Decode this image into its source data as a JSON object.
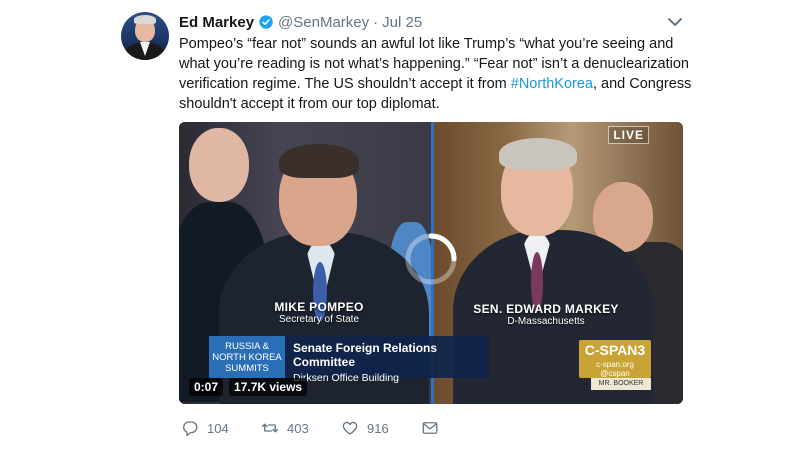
{
  "author": {
    "name": "Ed Markey",
    "handle": "@SenMarkey",
    "separator": "·",
    "date": "Jul 25"
  },
  "tweet": {
    "line1": "Pompeo’s “fear not” sounds an awful lot like Trump’s “what you’re seeing and",
    "line2": "what you’re reading is not what’s happening.” “Fear not” isn’t a denuclearization",
    "line3_pre": "verification regime. The US shouldn’t accept it from ",
    "hashtag": "#NorthKorea",
    "line3_post": ", and Congress",
    "line4": "shouldn't accept it from our top diplomat."
  },
  "video": {
    "live_badge": "LIVE",
    "left_name": "MIKE POMPEO",
    "left_title": "Secretary of State",
    "right_name": "SEN. EDWARD MARKEY",
    "right_title": "D-Massachusetts",
    "topic": "RUSSIA & NORTH KOREA SUMMITS",
    "event_title": "Senate Foreign Relations Committee",
    "event_location": "Dirksen Office Building",
    "network": "C-SPAN3",
    "network_url": "c-span.org",
    "network_handle": "@cspan",
    "nameplate": "MR. BOOKER",
    "time": "0:07",
    "views": "17.7K views"
  },
  "actions": {
    "replies": "104",
    "retweets": "403",
    "likes": "916"
  },
  "colors": {
    "accent": "#1da1f2",
    "hashtag": "#1b95e0",
    "muted": "#657786",
    "cspan_gold": "#c9a336",
    "topic_blue": "#2a6fb5"
  },
  "icons": {
    "verified": "verified-badge-icon",
    "caret": "chevron-down-icon",
    "reply": "reply-icon",
    "retweet": "retweet-icon",
    "like": "heart-icon",
    "dm": "envelope-icon",
    "loading": "loading-spinner-icon"
  }
}
